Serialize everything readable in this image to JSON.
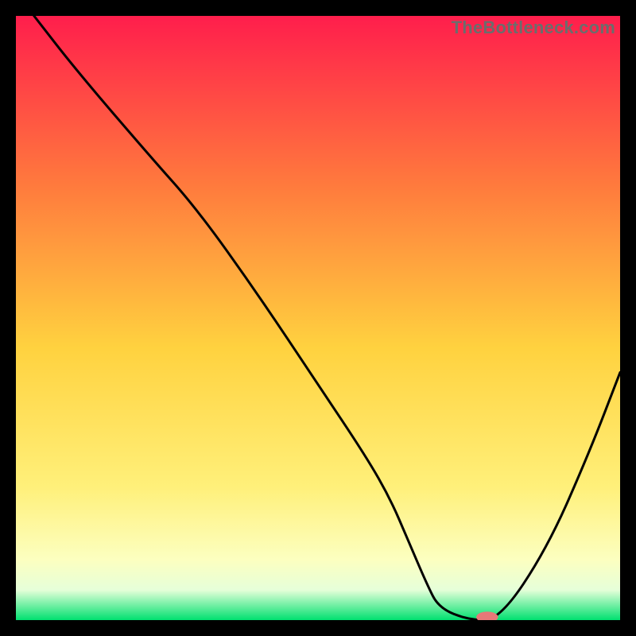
{
  "watermark": "TheBottleneck.com",
  "colors": {
    "gradient_top": "#ff1e4c",
    "gradient_mid1": "#ff7a3d",
    "gradient_mid2": "#ffd23f",
    "gradient_mid3": "#fff07a",
    "gradient_mid4": "#fcffc0",
    "gradient_bottom_band": "#e6ffd9",
    "gradient_bottom": "#00e070",
    "marker": "#e77878",
    "curve": "#000000"
  },
  "chart_data": {
    "type": "line",
    "title": "",
    "xlabel": "",
    "ylabel": "",
    "xlim": [
      0,
      100
    ],
    "ylim": [
      0,
      100
    ],
    "series": [
      {
        "name": "curve",
        "x": [
          3,
          10,
          22,
          30,
          40,
          50,
          58,
          62,
          65,
          68,
          70,
          75,
          80,
          88,
          95,
          100
        ],
        "y": [
          100,
          91,
          77,
          68,
          54,
          39,
          27,
          20,
          13,
          6,
          2,
          0,
          0,
          12,
          28,
          41
        ]
      }
    ],
    "marker": {
      "x": 78,
      "y": 0.5,
      "rx": 1.8,
      "ry": 0.9
    },
    "annotations": []
  }
}
